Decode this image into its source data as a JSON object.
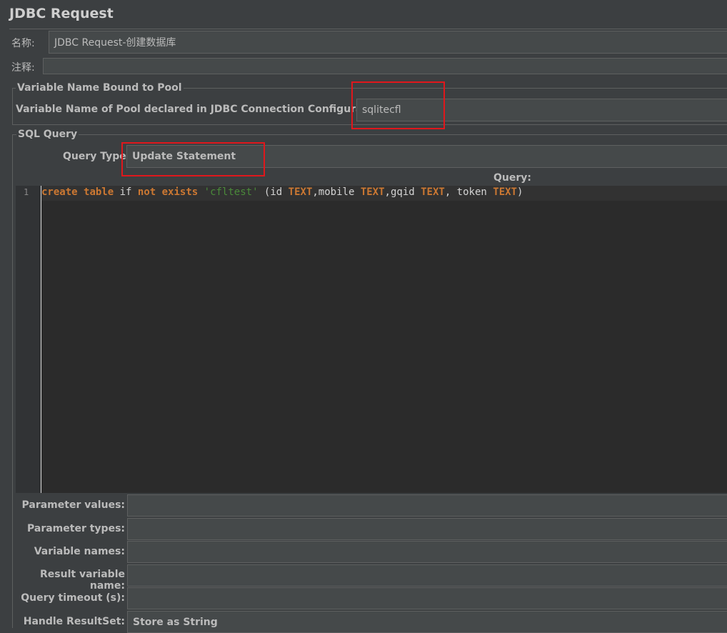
{
  "title": "JDBC Request",
  "name": {
    "label": "名称:",
    "value": "JDBC Request-创建数据库"
  },
  "comment": {
    "label": "注释:",
    "value": ""
  },
  "pool_group": {
    "legend": "Variable Name Bound to Pool",
    "label": "Variable Name of Pool declared in JDBC Connection Configuration",
    "value": "sqlitecfl"
  },
  "sql_group": {
    "legend": "SQL Query",
    "query_type_label": "Query Type:",
    "query_type_value": "Update Statement",
    "query_label": "Query:"
  },
  "editor": {
    "line_number": "1",
    "tokens": [
      {
        "t": "create",
        "k": "kw"
      },
      {
        "t": " ",
        "k": ""
      },
      {
        "t": "table",
        "k": "kw"
      },
      {
        "t": " if ",
        "k": ""
      },
      {
        "t": "not",
        "k": "kw"
      },
      {
        "t": " ",
        "k": ""
      },
      {
        "t": "exists",
        "k": "kw"
      },
      {
        "t": " ",
        "k": ""
      },
      {
        "t": "'cfltest'",
        "k": "str"
      },
      {
        "t": " (id ",
        "k": ""
      },
      {
        "t": "TEXT",
        "k": "kw"
      },
      {
        "t": ",mobile ",
        "k": ""
      },
      {
        "t": "TEXT",
        "k": "kw"
      },
      {
        "t": ",gqid ",
        "k": ""
      },
      {
        "t": "TEXT",
        "k": "kw"
      },
      {
        "t": ", token ",
        "k": ""
      },
      {
        "t": "TEXT",
        "k": "kw"
      },
      {
        "t": ")",
        "k": ""
      }
    ]
  },
  "params": {
    "parameter_values": {
      "label": "Parameter values:",
      "value": ""
    },
    "parameter_types": {
      "label": "Parameter types:",
      "value": ""
    },
    "variable_names": {
      "label": "Variable names:",
      "value": ""
    },
    "result_variable_name": {
      "label": "Result variable name:",
      "value": ""
    },
    "query_timeout": {
      "label": "Query timeout (s):",
      "value": ""
    },
    "handle_resultset": {
      "label": "Handle ResultSet:",
      "value": "Store as String"
    }
  }
}
